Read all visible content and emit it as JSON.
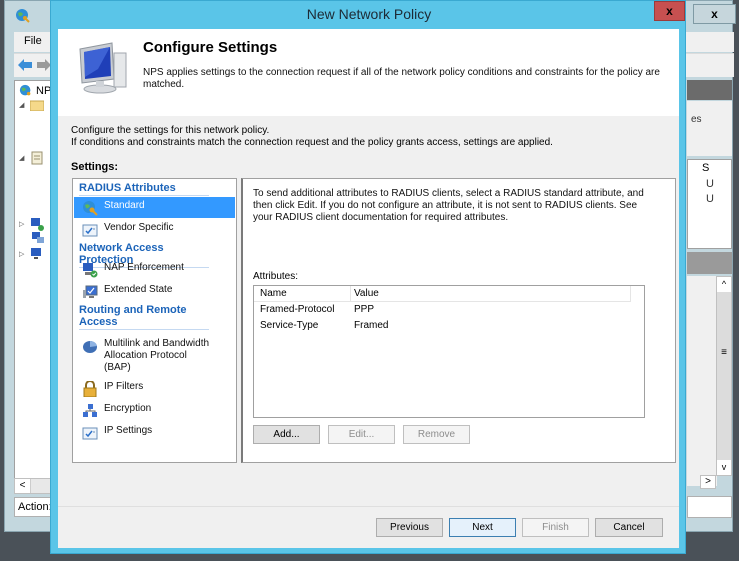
{
  "background_window": {
    "menu": {
      "file_label": "File"
    },
    "tree_root_label": "NP",
    "action_label": "Action:",
    "right_pane": {
      "partial_text": "es",
      "column_header": "S",
      "rows": [
        "U",
        "U"
      ]
    }
  },
  "dialog": {
    "title": "New Network Policy",
    "close_label": "x",
    "header": {
      "title": "Configure Settings",
      "description": "NPS applies settings to the connection request if all of the network policy conditions and constraints for the policy are matched."
    },
    "intro_line1": "Configure the settings for this network policy.",
    "intro_line2": "If conditions and constraints match the connection request and the policy grants access, settings are applied.",
    "settings_label": "Settings:",
    "nav": {
      "groups": [
        {
          "title": "RADIUS Attributes"
        },
        {
          "title": "Network Access Protection"
        },
        {
          "title": "Routing and Remote Access"
        }
      ],
      "items": [
        {
          "label": "Standard",
          "icon": "globe-key-icon",
          "selected": true
        },
        {
          "label": "Vendor Specific",
          "icon": "checklist-icon",
          "selected": false
        },
        {
          "label": "NAP Enforcement",
          "icon": "computer-check-icon",
          "selected": false
        },
        {
          "label": "Extended State",
          "icon": "monitor-state-icon",
          "selected": false
        },
        {
          "label": "Multilink and Bandwidth Allocation Protocol (BAP)",
          "icon": "pie-chart-icon",
          "selected": false
        },
        {
          "label": "IP Filters",
          "icon": "lock-icon",
          "selected": false
        },
        {
          "label": "Encryption",
          "icon": "network-icon",
          "selected": false
        },
        {
          "label": "IP Settings",
          "icon": "checklist-icon",
          "selected": false
        }
      ]
    },
    "content": {
      "description": "To send additional attributes to RADIUS clients, select a RADIUS standard attribute, and then click Edit. If you do not configure an attribute, it is not sent to RADIUS clients. See your RADIUS client documentation for required attributes.",
      "attributes_label": "Attributes:",
      "columns": [
        "Name",
        "Value"
      ],
      "rows": [
        {
          "name": "Framed-Protocol",
          "value": "PPP"
        },
        {
          "name": "Service-Type",
          "value": "Framed"
        }
      ],
      "buttons": {
        "add": "Add...",
        "edit": "Edit...",
        "remove": "Remove"
      }
    },
    "footer": {
      "previous": "Previous",
      "next": "Next",
      "finish": "Finish",
      "cancel": "Cancel"
    }
  }
}
